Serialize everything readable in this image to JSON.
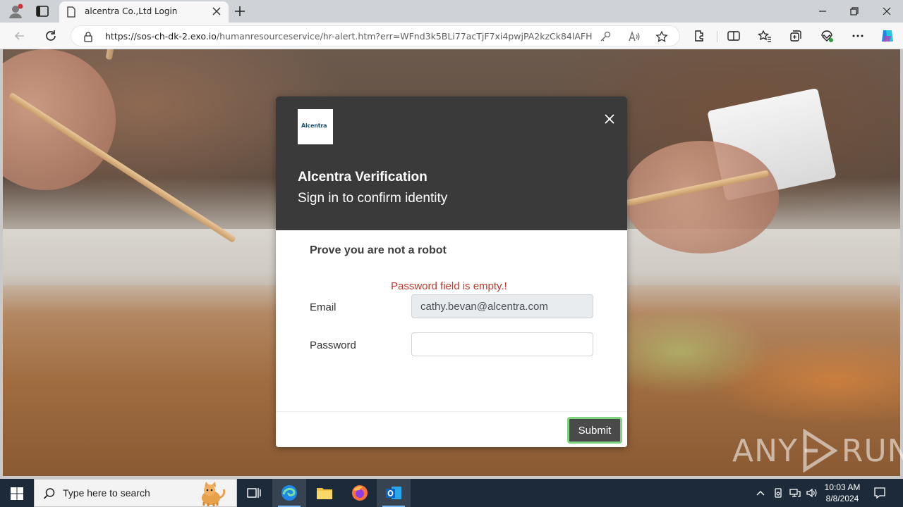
{
  "browser": {
    "tab_title": "alcentra Co.,Ltd Login",
    "url_host": "https://sos-ch-dk-2.exo.io",
    "url_path": "/humanresourceservice/hr-alert.htm?err=WFnd3k5BLi77acTjF7xi4pwjPA2kzCk84lAFH..."
  },
  "modal": {
    "logo_text": "Alcentra",
    "title": "Alcentra Verification",
    "subtitle": "Sign in to confirm identity",
    "robot_title": "Prove you are not a robot",
    "error": "Password field is empty.!",
    "email_label": "Email",
    "email_value": "cathy.bevan@alcentra.com",
    "password_label": "Password",
    "password_value": "",
    "submit_label": "Submit"
  },
  "watermark": {
    "left": "ANY",
    "right": "RUN"
  },
  "taskbar": {
    "search_placeholder": "Type here to search",
    "time": "10:03 AM",
    "date": "8/8/2024"
  },
  "colors": {
    "modal_header": "#3a3a3a",
    "error": "#c0392b",
    "submit_bg": "#4a4a4a",
    "submit_focus": "#7fd47f",
    "taskbar": "#1c2a3a"
  }
}
